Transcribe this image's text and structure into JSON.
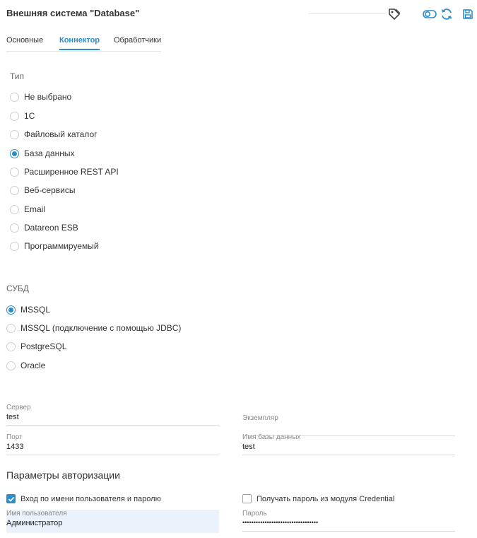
{
  "header": {
    "title": "Внешняя система \"Database\"",
    "icons": [
      "tag-icon",
      "toggle-icon",
      "refresh-icon",
      "save-icon"
    ]
  },
  "tabs": [
    {
      "label": "Основные",
      "active": false
    },
    {
      "label": "Коннектор",
      "active": true
    },
    {
      "label": "Обработчики",
      "active": false
    }
  ],
  "type_section": {
    "label": "Тип",
    "options": [
      {
        "label": "Не выбрано",
        "selected": false
      },
      {
        "label": "1С",
        "selected": false
      },
      {
        "label": "Файловый каталог",
        "selected": false
      },
      {
        "label": "База данных",
        "selected": true
      },
      {
        "label": "Расширенное REST API",
        "selected": false
      },
      {
        "label": "Веб-сервисы",
        "selected": false
      },
      {
        "label": "Email",
        "selected": false
      },
      {
        "label": "Datareon ESB",
        "selected": false
      },
      {
        "label": "Программируемый",
        "selected": false
      }
    ]
  },
  "dbms_section": {
    "label": "СУБД",
    "options": [
      {
        "label": "MSSQL",
        "selected": true
      },
      {
        "label": "MSSQL (подключение с помощью JDBC)",
        "selected": false
      },
      {
        "label": "PostgreSQL",
        "selected": false
      },
      {
        "label": "Oracle",
        "selected": false
      }
    ]
  },
  "fields": {
    "server": {
      "label": "Сервер",
      "value": "test"
    },
    "instance": {
      "label": "Экземпляр",
      "value": ""
    },
    "port": {
      "label": "Порт",
      "value": "1433"
    },
    "db_name": {
      "label": "Имя базы данных",
      "value": "test"
    }
  },
  "auth": {
    "title": "Параметры авторизации",
    "login_checkbox": {
      "label": "Вход по имени пользователя и паролю",
      "checked": true
    },
    "credential_checkbox": {
      "label": "Получать пароль из модуля Credential",
      "checked": false
    },
    "username": {
      "label": "Имя пользователя",
      "value": "Администратор"
    },
    "password": {
      "label": "Пароль",
      "value": "••••••••••••••••••••••••••••••••••"
    }
  },
  "colors": {
    "accent": "#2b8ccc",
    "text": "#333333",
    "muted": "#8a8a8a"
  }
}
